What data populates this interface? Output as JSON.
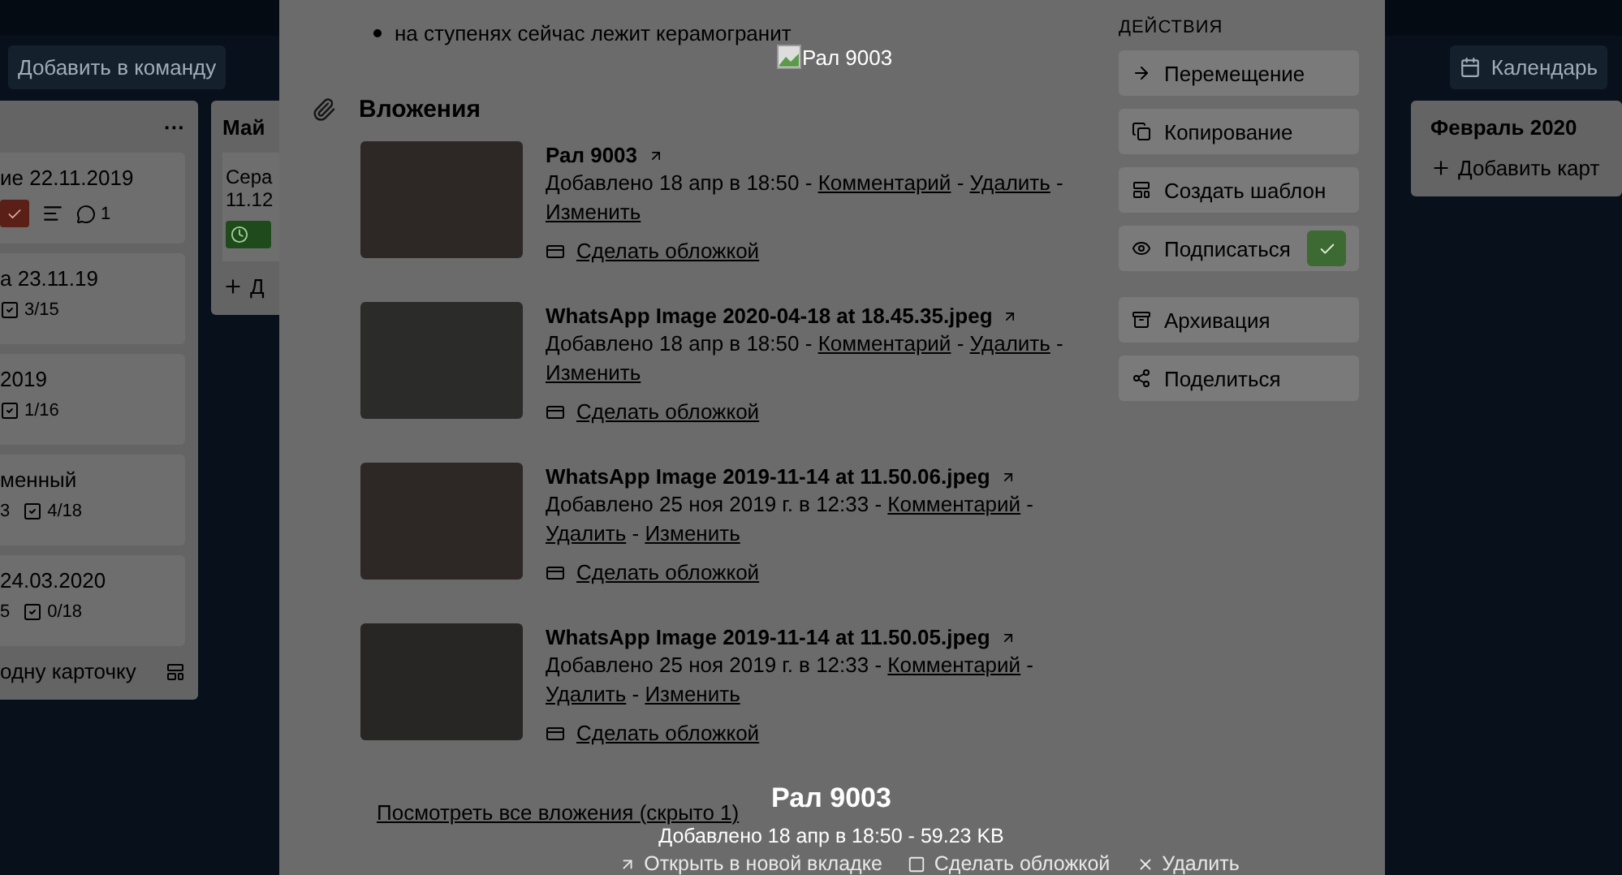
{
  "board": {
    "header_buttons": [
      "Добавить в команду"
    ],
    "calendar_button": "Календарь",
    "lists": [
      {
        "menu": "···",
        "cards": [
          {
            "title": "ие 22.11.2019",
            "badges": [
              {
                "kind": "overdue"
              },
              {
                "kind": "description"
              },
              {
                "kind": "comments",
                "text": "1"
              }
            ]
          },
          {
            "title": "а 23.11.19",
            "badges": [
              {
                "kind": "checklist",
                "text": "3/15"
              }
            ]
          },
          {
            "title": "2019",
            "badges": [
              {
                "kind": "checklist",
                "text": "1/16"
              }
            ]
          },
          {
            "title": "менный",
            "badges": [
              {
                "kind": "count",
                "text": "3"
              },
              {
                "kind": "checklist",
                "text": "4/18"
              }
            ]
          },
          {
            "title": "24.03.2020",
            "badges": [
              {
                "kind": "count",
                "text": "5"
              },
              {
                "kind": "checklist",
                "text": "0/18"
              }
            ]
          }
        ],
        "add_card": "одну карточку"
      },
      {
        "title": "Май",
        "cards": [
          {
            "title": "Сера 11.12",
            "badges": [
              {
                "kind": "due"
              }
            ]
          }
        ],
        "add_card": "Д"
      },
      {
        "title": "Февраль 2020",
        "add_card": "Добавить карт"
      }
    ]
  },
  "card_modal": {
    "bullet": "на ступенях сейчас лежит керамогранит",
    "broken_image_alt": "Рал 9003",
    "attachments_title": "Вложения",
    "separator": "-",
    "attachments": [
      {
        "name": "Рал 9003",
        "added": "Добавлено 18 апр в 18:50",
        "links": [
          "Комментарий",
          "Удалить",
          "Изменить"
        ],
        "cover": "Сделать обложкой"
      },
      {
        "name": "WhatsApp Image 2020-04-18 at 18.45.35.jpeg",
        "added": "Добавлено 18 апр в 18:50",
        "links": [
          "Комментарий",
          "Удалить",
          "Изменить"
        ],
        "cover": "Сделать обложкой"
      },
      {
        "name": "WhatsApp Image 2019-11-14 at 11.50.06.jpeg",
        "added": "Добавлено 25 ноя 2019 г. в 12:33",
        "links": [
          "Комментарий",
          "Удалить",
          "Изменить"
        ],
        "cover": "Сделать обложкой"
      },
      {
        "name": "WhatsApp Image 2019-11-14 at 11.50.05.jpeg",
        "added": "Добавлено 25 ноя 2019 г. в 12:33",
        "links": [
          "Комментарий",
          "Удалить",
          "Изменить"
        ],
        "cover": "Сделать обложкой"
      }
    ],
    "show_all": "Посмотреть все вложения (скрыто 1)",
    "sidebar": {
      "title": "ДЕЙСТВИЯ",
      "groups": [
        [
          {
            "label": "Перемещение",
            "kind": "action"
          },
          {
            "label": "Копирование",
            "kind": "action"
          },
          {
            "label": "Создать шаблон",
            "kind": "action"
          },
          {
            "label": "Подписаться",
            "kind": "toggle",
            "checked": true
          }
        ],
        [
          {
            "label": "Архивация",
            "kind": "action"
          },
          {
            "label": "Поделиться",
            "kind": "action"
          }
        ]
      ]
    }
  },
  "viewer": {
    "title": "Рал 9003",
    "meta": "Добавлено 18 апр в 18:50 - 59.23 KB",
    "actions": [
      "Открыть в новой вкладке",
      "Сделать обложкой",
      "Удалить"
    ]
  }
}
